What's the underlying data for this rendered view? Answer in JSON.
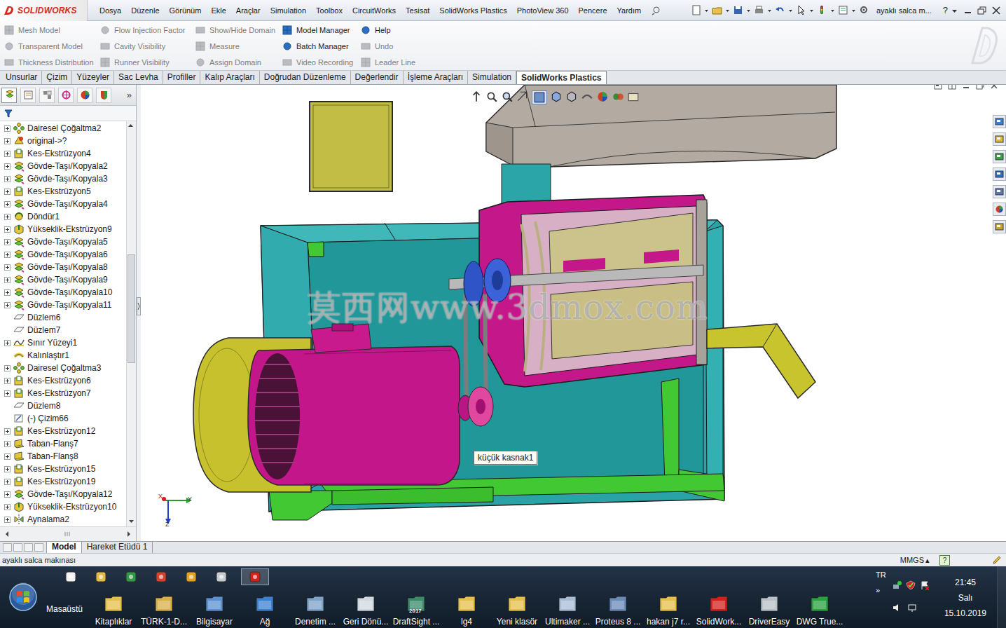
{
  "app": {
    "logo": "SOLIDWORKS",
    "document_title": "ayaklı salca m...",
    "help": "?"
  },
  "menu": [
    "Dosya",
    "Düzenle",
    "Görünüm",
    "Ekle",
    "Araçlar",
    "Simulation",
    "Toolbox",
    "CircuitWorks",
    "Tesisat",
    "SolidWorks Plastics",
    "PhotoView 360",
    "Pencere",
    "Yardım"
  ],
  "ribbon": {
    "columns": [
      [
        {
          "label": "Mesh Model",
          "disabled": true
        },
        {
          "label": "Transparent Model",
          "disabled": true
        },
        {
          "label": "Thickness Distribution",
          "disabled": true
        }
      ],
      [
        {
          "label": "Flow Injection Factor",
          "disabled": true
        },
        {
          "label": "Cavity Visibility",
          "disabled": true
        },
        {
          "label": "Runner Visibility",
          "disabled": true
        }
      ],
      [
        {
          "label": "Show/Hide Domain",
          "disabled": true
        },
        {
          "label": "Measure",
          "disabled": true
        },
        {
          "label": "Assign Domain",
          "disabled": true
        }
      ],
      [
        {
          "label": "Model Manager",
          "disabled": false
        },
        {
          "label": "Batch Manager",
          "disabled": false
        },
        {
          "label": "Video Recording",
          "disabled": true
        }
      ],
      [
        {
          "label": "Help",
          "disabled": false
        },
        {
          "label": "Undo",
          "disabled": true
        },
        {
          "label": "Leader Line",
          "disabled": true
        }
      ]
    ]
  },
  "tabs": [
    {
      "label": "Unsurlar",
      "selected": false
    },
    {
      "label": "Çizim",
      "selected": false
    },
    {
      "label": "Yüzeyler",
      "selected": false
    },
    {
      "label": "Sac Levha",
      "selected": false
    },
    {
      "label": "Profiller",
      "selected": false
    },
    {
      "label": "Kalıp Araçları",
      "selected": false
    },
    {
      "label": "Doğrudan Düzenleme",
      "selected": false
    },
    {
      "label": "Değerlendir",
      "selected": false
    },
    {
      "label": "İşleme Araçları",
      "selected": false
    },
    {
      "label": "Simulation",
      "selected": false
    },
    {
      "label": "SolidWorks Plastics",
      "selected": true
    }
  ],
  "feature_tree": {
    "panel_more": "»",
    "items": [
      {
        "label": "Dairesel Çoğaltma2",
        "kind": "pattern",
        "expandable": true
      },
      {
        "label": "original->?",
        "kind": "original",
        "expandable": true
      },
      {
        "label": "Kes-Ekstrüzyon4",
        "kind": "cut",
        "expandable": true
      },
      {
        "label": "Gövde-Taşı/Kopyala2",
        "kind": "move",
        "expandable": true
      },
      {
        "label": "Gövde-Taşı/Kopyala3",
        "kind": "move",
        "expandable": true
      },
      {
        "label": "Kes-Ekstrüzyon5",
        "kind": "cut",
        "expandable": true
      },
      {
        "label": "Gövde-Taşı/Kopyala4",
        "kind": "move",
        "expandable": true
      },
      {
        "label": "Döndür1",
        "kind": "rotate",
        "expandable": true
      },
      {
        "label": "Yükseklik-Ekstrüzyon9",
        "kind": "extrude",
        "expandable": true
      },
      {
        "label": "Gövde-Taşı/Kopyala5",
        "kind": "move",
        "expandable": true
      },
      {
        "label": "Gövde-Taşı/Kopyala6",
        "kind": "move",
        "expandable": true
      },
      {
        "label": "Gövde-Taşı/Kopyala8",
        "kind": "move",
        "expandable": true
      },
      {
        "label": "Gövde-Taşı/Kopyala9",
        "kind": "move",
        "expandable": true
      },
      {
        "label": "Gövde-Taşı/Kopyala10",
        "kind": "move",
        "expandable": true
      },
      {
        "label": "Gövde-Taşı/Kopyala11",
        "kind": "move",
        "expandable": true
      },
      {
        "label": "Düzlem6",
        "kind": "plane",
        "expandable": false
      },
      {
        "label": "Düzlem7",
        "kind": "plane",
        "expandable": false
      },
      {
        "label": "Sınır Yüzeyi1",
        "kind": "boundary",
        "expandable": true
      },
      {
        "label": "Kalınlaştır1",
        "kind": "thicken",
        "expandable": false
      },
      {
        "label": "Dairesel Çoğaltma3",
        "kind": "pattern",
        "expandable": true
      },
      {
        "label": "Kes-Ekstrüzyon6",
        "kind": "cut",
        "expandable": true
      },
      {
        "label": "Kes-Ekstrüzyon7",
        "kind": "cut",
        "expandable": true
      },
      {
        "label": "Düzlem8",
        "kind": "plane",
        "expandable": false
      },
      {
        "label": "(-) Çizim66",
        "kind": "sketch",
        "expandable": false
      },
      {
        "label": "Kes-Ekstrüzyon12",
        "kind": "cut",
        "expandable": true
      },
      {
        "label": "Taban-Flanş7",
        "kind": "flange",
        "expandable": true
      },
      {
        "label": "Taban-Flanş8",
        "kind": "flange",
        "expandable": true
      },
      {
        "label": "Kes-Ekstrüzyon15",
        "kind": "cut",
        "expandable": true
      },
      {
        "label": "Kes-Ekstrüzyon19",
        "kind": "cut",
        "expandable": true
      },
      {
        "label": "Gövde-Taşı/Kopyala12",
        "kind": "move",
        "expandable": true
      },
      {
        "label": "Yükseklik-Ekstrüzyon10",
        "kind": "extrude",
        "expandable": true
      },
      {
        "label": "Aynalama2",
        "kind": "mirror",
        "expandable": true
      }
    ]
  },
  "viewport": {
    "callout": "küçük kasnak1",
    "watermark": "莫西网www.3dmox.com",
    "axes": {
      "x": "X",
      "y": "Y",
      "z": "Z"
    }
  },
  "bottom_tabs": [
    {
      "label": "Model",
      "selected": true
    },
    {
      "label": "Hareket Etüdü 1",
      "selected": false
    }
  ],
  "status_bar": {
    "text": "ayaklı salca makınası",
    "units": "MMGS",
    "units_arrow": "▴",
    "help": "?"
  },
  "taskbar": {
    "desktop": "Masaüstü",
    "quick_launch": [
      {
        "color": "#f2f2f2",
        "selected": false
      },
      {
        "color": "#e3bb45",
        "selected": false
      },
      {
        "color": "#2f9a45",
        "selected": false
      },
      {
        "color": "#d8402e",
        "selected": false
      },
      {
        "color": "#e4a322",
        "selected": false
      },
      {
        "color": "#c8ccd2",
        "selected": false
      },
      {
        "color": "#d3201c",
        "selected": true
      }
    ],
    "items": [
      {
        "label": "Kitaplıklar",
        "color": "#e6c04c"
      },
      {
        "label": "TÜRK-1-D...",
        "color": "#d8b04a"
      },
      {
        "label": "Bilgisayar",
        "color": "#5b90d2"
      },
      {
        "label": "Ağ",
        "color": "#3c80d0"
      },
      {
        "label": "Denetim ...",
        "color": "#7ea2c8"
      },
      {
        "label": "Geri Dönü...",
        "color": "#cfd8e0"
      },
      {
        "label": "DraftSight ...",
        "color": "#3a8a6a",
        "badge": "2017"
      },
      {
        "label": "lg4",
        "color": "#e6c04c"
      },
      {
        "label": "Yeni klasör",
        "color": "#e6c04c"
      },
      {
        "label": "Ultimaker ...",
        "color": "#a8bcd4"
      },
      {
        "label": "Proteus 8 ...",
        "color": "#6a8ab8"
      },
      {
        "label": "hakan j7 r...",
        "color": "#e6c04c"
      },
      {
        "label": "SolidWork...",
        "color": "#d3201c"
      },
      {
        "label": "DriverEasy",
        "color": "#b8c0c8"
      },
      {
        "label": "DWG True...",
        "color": "#2aa040"
      }
    ],
    "tray": {
      "language": "TR",
      "expand": "»",
      "time": "21:45",
      "day": "Salı",
      "date": "15.10.2019"
    }
  }
}
